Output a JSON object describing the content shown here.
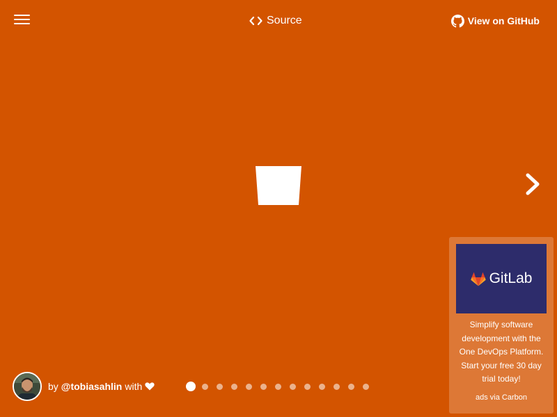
{
  "header": {
    "menu_icon": "hamburger-menu-icon",
    "source_icon": "code-brackets-icon",
    "source_label": "Source",
    "github_icon": "github-logo-icon",
    "github_label": "View on GitHub"
  },
  "main": {
    "spinner_icon": "cup-shape-icon",
    "next_icon": "chevron-right-icon"
  },
  "footer": {
    "avatar_icon": "author-avatar",
    "by_label": "by",
    "author_handle": "@tobiasahlin",
    "with_label": "with",
    "heart_icon": "heart-icon",
    "pagination": {
      "total": 13,
      "current": 1
    }
  },
  "ad": {
    "brand": "GitLab",
    "brand_icon": "gitlab-fox-icon",
    "text": "Simplify software development with the One DevOps Platform. Start your free 30 day trial today!",
    "via": "ads via Carbon"
  },
  "colors": {
    "background": "#d35400",
    "ad_background": "#dd7836",
    "ad_image_background": "#2d2c6b",
    "foreground": "#ffffff"
  }
}
